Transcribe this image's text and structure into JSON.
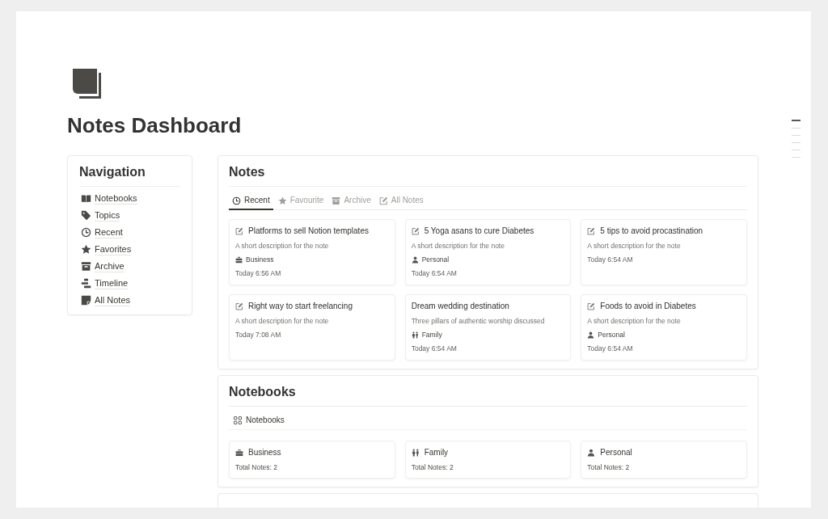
{
  "page": {
    "title": "Notes Dashboard"
  },
  "navigation": {
    "title": "Navigation",
    "items": [
      {
        "label": "Notebooks",
        "kind": "book"
      },
      {
        "label": "Topics",
        "kind": "tag"
      },
      {
        "label": "Recent",
        "kind": "clock"
      },
      {
        "label": "Favorites",
        "kind": "star"
      },
      {
        "label": "Archive",
        "kind": "archive"
      },
      {
        "label": "Timeline",
        "kind": "timeline"
      },
      {
        "label": "All Notes",
        "kind": "note"
      }
    ]
  },
  "notes": {
    "title": "Notes",
    "tabs": [
      {
        "label": "Recent",
        "kind": "clock",
        "selected": true
      },
      {
        "label": "Favourite",
        "kind": "star",
        "selected": false
      },
      {
        "label": "Archive",
        "kind": "archive",
        "selected": false
      },
      {
        "label": "All Notes",
        "kind": "edit",
        "selected": false
      }
    ],
    "cards": [
      {
        "title": "Platforms to sell Notion templates",
        "kind": "edit",
        "description": "A short description for the note",
        "tag": {
          "label": "Business",
          "kind": "briefcase"
        },
        "time": "Today 6:56 AM"
      },
      {
        "title": "5 Yoga asans to cure Diabetes",
        "kind": "edit",
        "description": "A short description for the note",
        "tag": {
          "label": "Personal",
          "kind": "person"
        },
        "time": "Today 6:54 AM"
      },
      {
        "title": "5 tips to avoid procastination",
        "kind": "edit",
        "description": "A short description for the note",
        "time": "Today 6:54 AM"
      },
      {
        "title": "Right way to start freelancing",
        "kind": "edit",
        "description": "A short description for the note",
        "time": "Today 7:08 AM"
      },
      {
        "title": "Dream wedding destination",
        "kind": "plain",
        "description": "Three pillars of authentic worship discussed",
        "tag": {
          "label": "Family",
          "kind": "people"
        },
        "time": "Today 6:54 AM"
      },
      {
        "title": "Foods to avoid in Diabetes",
        "kind": "edit",
        "description": "A short description for the note",
        "tag": {
          "label": "Personal",
          "kind": "person"
        },
        "time": "Today 6:54 AM"
      }
    ]
  },
  "notebooks": {
    "title": "Notebooks",
    "view": {
      "label": "Notebooks",
      "kind": "grid"
    },
    "cards": [
      {
        "title": "Business",
        "kind": "briefcase",
        "count": "Total Notes: 2"
      },
      {
        "title": "Family",
        "kind": "people",
        "count": "Total Notes: 2"
      },
      {
        "title": "Personal",
        "kind": "person",
        "count": "Total Notes: 2"
      }
    ]
  },
  "outline": [
    {
      "selected": true
    },
    {
      "selected": false
    },
    {
      "selected": false
    },
    {
      "selected": false
    },
    {
      "selected": false
    },
    {
      "selected": false
    }
  ]
}
